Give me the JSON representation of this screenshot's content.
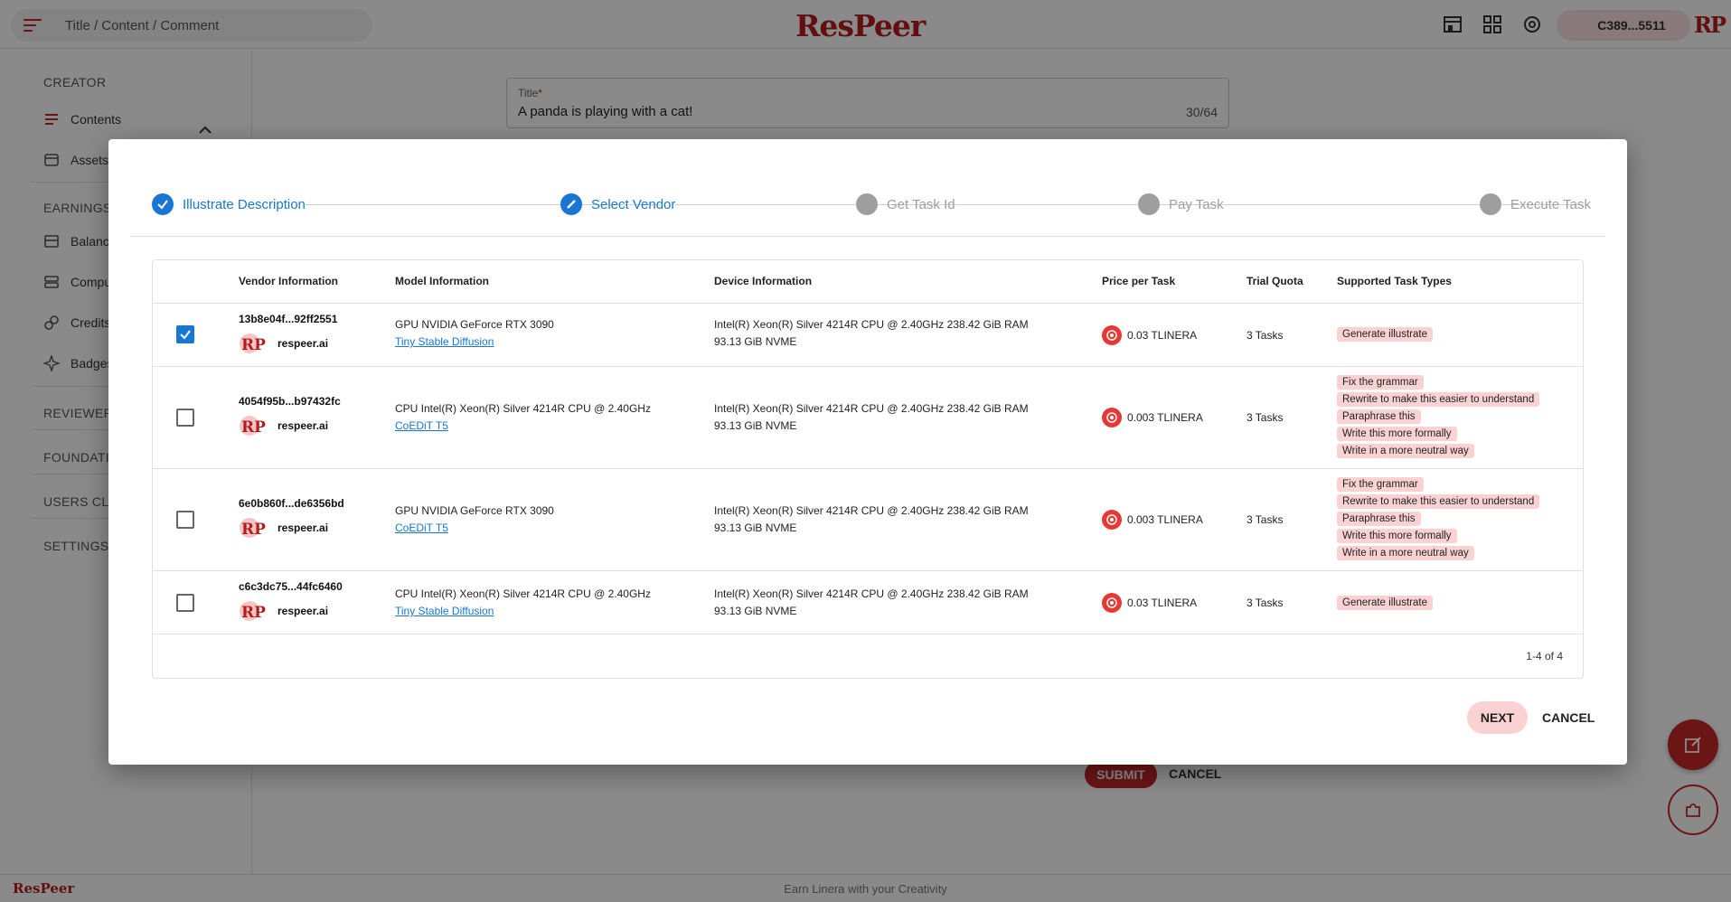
{
  "header": {
    "breadcrumb": "Title / Content / Comment",
    "logo": "ResPeer",
    "account": "C389...5511",
    "avatar_text": "RP"
  },
  "sidebar": {
    "creator_section": "CREATOR",
    "contents": "Contents",
    "assets": "Assets",
    "earnings_section": "EARNINGS",
    "balance": "Balance",
    "computing": "Computing",
    "credits": "Credits",
    "badges": "Badges",
    "reviewer_section": "REVIEWER",
    "foundation_section": "FOUNDATION",
    "users_section": "USERS CLUB",
    "settings_section": "SETTINGS"
  },
  "form": {
    "title_label": "Title",
    "required_mark": "*",
    "title_value": "A panda is playing with a cat!",
    "title_counter": "30/64",
    "submit": "SUBMIT",
    "cancel": "CANCEL"
  },
  "dialog": {
    "steps": [
      {
        "label": "Illustrate Description",
        "state": "done"
      },
      {
        "label": "Select Vendor",
        "state": "active"
      },
      {
        "label": "Get Task Id",
        "state": "todo"
      },
      {
        "label": "Pay Task",
        "state": "todo"
      },
      {
        "label": "Execute Task",
        "state": "todo"
      }
    ],
    "columns": [
      "Vendor Information",
      "Model Information",
      "Device Information",
      "Price per Task",
      "Trial Quota",
      "Supported Task Types"
    ],
    "rows": [
      {
        "checked": true,
        "vendor_id": "13b8e04f...92ff2551",
        "vendor_name": "respeer.ai",
        "model_hw": "GPU NVIDIA GeForce RTX 3090",
        "model_name": "Tiny Stable Diffusion",
        "device_line1": "Intel(R) Xeon(R) Silver 4214R CPU @ 2.40GHz 238.42 GiB RAM",
        "device_line2": "93.13 GiB NVME",
        "price": "0.03 TLINERA",
        "quota": "3 Tasks",
        "tasks": [
          "Generate illustrate"
        ]
      },
      {
        "checked": false,
        "vendor_id": "4054f95b...b97432fc",
        "vendor_name": "respeer.ai",
        "model_hw": "CPU Intel(R) Xeon(R) Silver 4214R CPU @ 2.40GHz",
        "model_name": "CoEDiT T5",
        "device_line1": "Intel(R) Xeon(R) Silver 4214R CPU @ 2.40GHz 238.42 GiB RAM",
        "device_line2": "93.13 GiB NVME",
        "price": "0.003 TLINERA",
        "quota": "3 Tasks",
        "tasks": [
          "Fix the grammar",
          "Rewrite to make this easier to understand",
          "Paraphrase this",
          "Write this more formally",
          "Write in a more neutral way"
        ]
      },
      {
        "checked": false,
        "vendor_id": "6e0b860f...de6356bd",
        "vendor_name": "respeer.ai",
        "model_hw": "GPU NVIDIA GeForce RTX 3090",
        "model_name": "CoEDiT T5",
        "device_line1": "Intel(R) Xeon(R) Silver 4214R CPU @ 2.40GHz 238.42 GiB RAM",
        "device_line2": "93.13 GiB NVME",
        "price": "0.003 TLINERA",
        "quota": "3 Tasks",
        "tasks": [
          "Fix the grammar",
          "Rewrite to make this easier to understand",
          "Paraphrase this",
          "Write this more formally",
          "Write in a more neutral way"
        ]
      },
      {
        "checked": false,
        "vendor_id": "c6c3dc75...44fc6460",
        "vendor_name": "respeer.ai",
        "model_hw": "CPU Intel(R) Xeon(R) Silver 4214R CPU @ 2.40GHz",
        "model_name": "Tiny Stable Diffusion",
        "device_line1": "Intel(R) Xeon(R) Silver 4214R CPU @ 2.40GHz 238.42 GiB RAM",
        "device_line2": "93.13 GiB NVME",
        "price": "0.03 TLINERA",
        "quota": "3 Tasks",
        "tasks": [
          "Generate illustrate"
        ]
      }
    ],
    "pagination": "1-4 of 4",
    "next": "NEXT",
    "cancel": "CANCEL"
  },
  "footer": {
    "logo": "ResPeer",
    "tagline": "Earn Linera with your Creativity"
  },
  "colors": {
    "brand": "#b71c1c",
    "accent": "#c62828",
    "step_active": "#1976d2",
    "step_todo": "#9e9e9e",
    "chip_bg": "#fbd2d2"
  }
}
